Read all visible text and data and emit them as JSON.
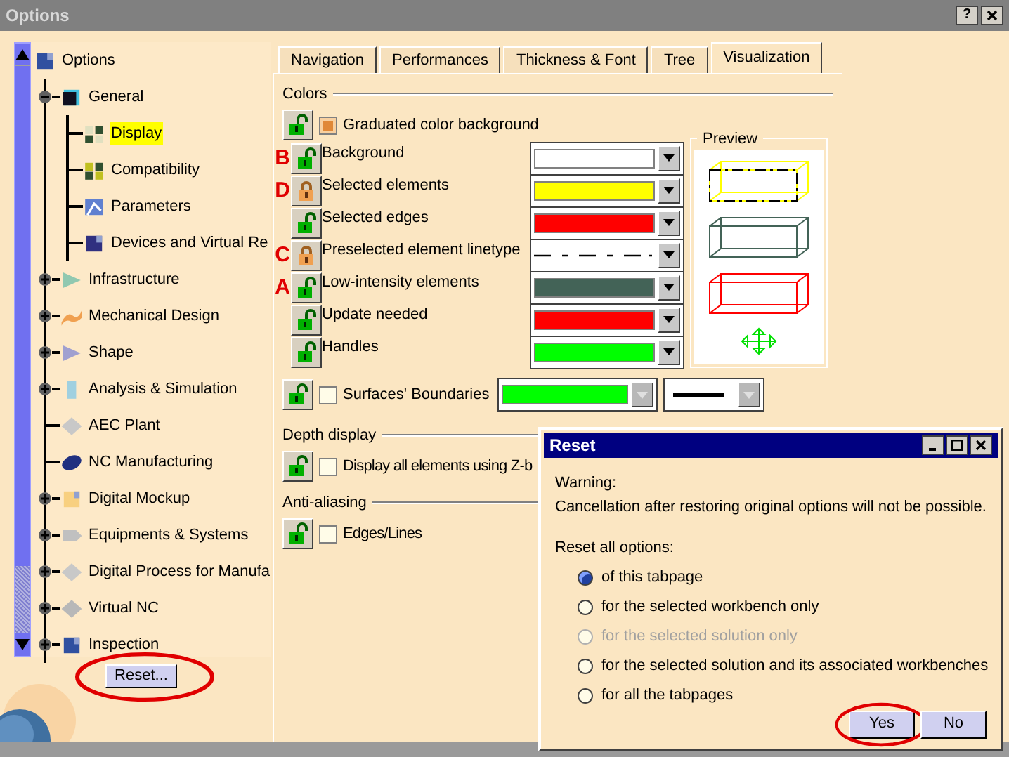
{
  "window": {
    "title": "Options",
    "help_button": "?"
  },
  "tree": {
    "label": "Options",
    "selected": false,
    "children": [
      {
        "label": "General",
        "kind": "expanded",
        "selected": false,
        "children": [
          {
            "label": "Display",
            "kind": "leaf",
            "selected": true
          },
          {
            "label": "Compatibility",
            "kind": "leaf",
            "selected": false
          },
          {
            "label": "Parameters",
            "kind": "leaf",
            "selected": false
          },
          {
            "label": "Devices and Virtual Re",
            "kind": "leaf",
            "selected": false
          }
        ]
      },
      {
        "label": "Infrastructure",
        "kind": "collapsed",
        "selected": false
      },
      {
        "label": "Mechanical Design",
        "kind": "collapsed",
        "selected": false
      },
      {
        "label": "Shape",
        "kind": "collapsed",
        "selected": false
      },
      {
        "label": "Analysis & Simulation",
        "kind": "collapsed",
        "selected": false
      },
      {
        "label": "AEC Plant",
        "kind": "leaf",
        "selected": false
      },
      {
        "label": "NC Manufacturing",
        "kind": "leaf",
        "selected": false
      },
      {
        "label": "Digital Mockup",
        "kind": "collapsed",
        "selected": false
      },
      {
        "label": "Equipments & Systems",
        "kind": "collapsed",
        "selected": false
      },
      {
        "label": "Digital Process for Manufa",
        "kind": "collapsed",
        "selected": false
      },
      {
        "label": "Virtual NC",
        "kind": "collapsed",
        "selected": false
      },
      {
        "label": "Inspection",
        "kind": "collapsed",
        "selected": false
      }
    ]
  },
  "reset_button": {
    "label": "Reset...",
    "circled": true
  },
  "tabs": [
    {
      "label": "Navigation",
      "selected": false
    },
    {
      "label": "Performances",
      "selected": false
    },
    {
      "label": "Thickness & Font",
      "selected": false
    },
    {
      "label": "Tree",
      "selected": false
    },
    {
      "label": "Visualization",
      "selected": true
    }
  ],
  "colors": {
    "title": "Colors",
    "graduated": {
      "label": "Graduated color background",
      "checked": true,
      "locked": false
    },
    "rows": [
      {
        "label": "Background",
        "annotation": "B",
        "locked": false,
        "kind": "color",
        "color": "#ffffff"
      },
      {
        "label": "Selected elements",
        "annotation": "D",
        "locked": true,
        "kind": "color",
        "color": "#ffff00"
      },
      {
        "label": "Selected edges",
        "locked": false,
        "kind": "color",
        "color": "#ff0000"
      },
      {
        "label": "Preselected element linetype",
        "annotation": "C",
        "locked": true,
        "kind": "linetype"
      },
      {
        "label": "Low-intensity elements",
        "annotation": "A",
        "locked": false,
        "kind": "color",
        "color": "#436357"
      },
      {
        "label": "Update needed",
        "locked": false,
        "kind": "color",
        "color": "#ff0000"
      },
      {
        "label": "Handles",
        "locked": false,
        "kind": "color",
        "color": "#00ff00"
      }
    ],
    "preview": {
      "title": "Preview"
    },
    "surfaces": {
      "label": "Surfaces' Boundaries",
      "checked": false,
      "locked": false,
      "color": "#00ff00"
    }
  },
  "depth": {
    "title": "Depth display",
    "option": {
      "label": "Display all elements using Z-b",
      "checked": false,
      "locked": false
    }
  },
  "antialiasing": {
    "title": "Anti-aliasing",
    "option": {
      "label": "Edges/Lines",
      "checked": false,
      "locked": false
    }
  },
  "dialog": {
    "title": "Reset",
    "warning": "Warning:",
    "message": "Cancellation after restoring original options will not be possible.",
    "prompt": "Reset all options:",
    "options": [
      {
        "label": "of this tabpage",
        "selected": true,
        "disabled": false
      },
      {
        "label": "for the selected workbench only",
        "selected": false,
        "disabled": false
      },
      {
        "label": "for the selected solution only",
        "selected": false,
        "disabled": true
      },
      {
        "label": "for the selected solution and its associated workbenches",
        "selected": false,
        "disabled": false
      },
      {
        "label": "for all the tabpages",
        "selected": false,
        "disabled": false
      }
    ],
    "buttons": [
      {
        "label": "Yes",
        "circled": true
      },
      {
        "label": "No",
        "circled": false
      }
    ]
  }
}
